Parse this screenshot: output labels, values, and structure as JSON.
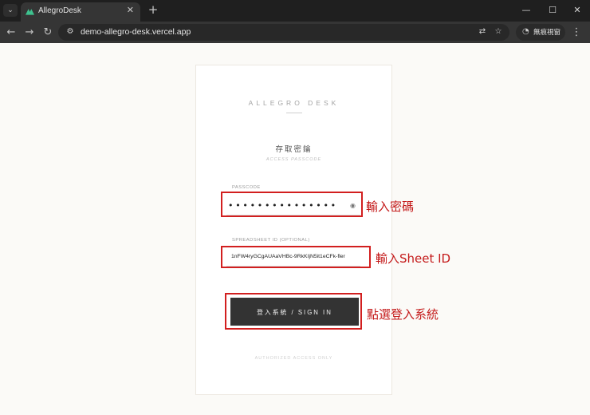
{
  "browser": {
    "tab_title": "AllegroDesk",
    "url": "demo-allegro-desk.vercel.app",
    "incognito_label": "無痕視窗"
  },
  "login": {
    "brand": "ALLEGRO DESK",
    "heading": "存取密鑰",
    "subheading": "ACCESS PASSCODE",
    "passcode_label": "PASSCODE",
    "passcode_mask": "•••••••••••••••",
    "sheet_label": "SPREADSHEET ID (OPTIONAL)",
    "sheet_value": "1nFW4ryGCgAUAaVHBc-9RkKIjN5it1eCFk-fler",
    "signin_label": "登入系統 / SIGN IN",
    "footer": "AUTHORIZED ACCESS ONLY"
  },
  "annotations": {
    "passcode_note": "輸入密碼",
    "sheet_note": "輸入Sheet ID",
    "signin_note": "點選登入系統"
  },
  "colors": {
    "annotation": "#d21f1f",
    "button": "#333333",
    "page_bg": "#fbfaf7"
  }
}
